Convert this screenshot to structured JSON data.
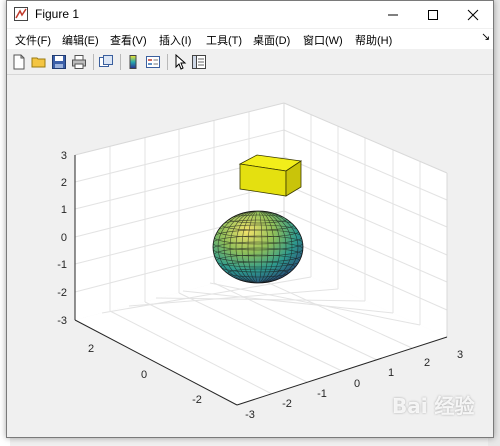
{
  "window": {
    "title": "Figure 1"
  },
  "menu": [
    {
      "label": "文件(F)"
    },
    {
      "label": "编辑(E)"
    },
    {
      "label": "查看(V)"
    },
    {
      "label": "插入(I)"
    },
    {
      "label": "工具(T)"
    },
    {
      "label": "桌面(D)"
    },
    {
      "label": "窗口(W)"
    },
    {
      "label": "帮助(H)"
    }
  ],
  "toolbar": [
    "new-figure-icon",
    "open-file-icon",
    "save-icon",
    "print-icon",
    "link-plot-icon",
    "insert-colorbar-icon",
    "insert-legend-icon",
    "edit-plot-arrow-icon",
    "property-inspector-icon"
  ],
  "plot": {
    "z_ticks": [
      "3",
      "2",
      "1",
      "0",
      "-1",
      "-2",
      "-3"
    ],
    "y_ticks": [
      "2",
      "0",
      "-2"
    ],
    "x_ticks": [
      "-3",
      "-2",
      "-1",
      "0",
      "1",
      "2",
      "3"
    ],
    "cube_color": "#f2ee1a"
  },
  "watermark": "Bai 经验"
}
